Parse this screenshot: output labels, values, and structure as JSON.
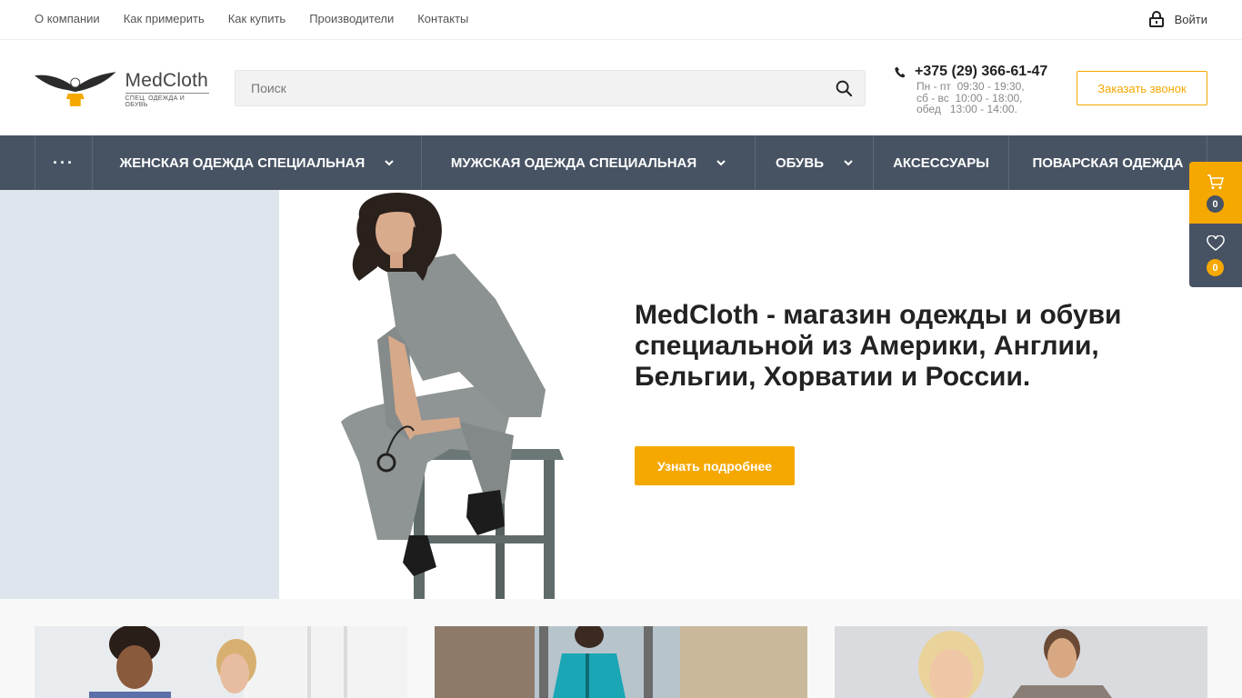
{
  "topbar": {
    "links": [
      "О компании",
      "Как примерить",
      "Как купить",
      "Производители",
      "Контакты"
    ],
    "login_label": "Войти"
  },
  "header": {
    "logo_title": "MedCloth",
    "logo_subtitle": "СПЕЦ. ОДЕЖДА И ОБУВЬ",
    "search_placeholder": "Поиск",
    "phone": "+375 (29) 366-61-47",
    "hours": [
      "Пн - пт  09:30 - 19:30,",
      "сб - вс  10:00 - 18:00,",
      "обед   13:00 - 14:00."
    ],
    "callback_label": "Заказать звонок"
  },
  "nav": {
    "more_label": "···",
    "items": [
      {
        "label": "Женская одежда специальная",
        "dropdown": true
      },
      {
        "label": "Мужская одежда специальная",
        "dropdown": true
      },
      {
        "label": "Обувь",
        "dropdown": true
      },
      {
        "label": "Аксессуары",
        "dropdown": false
      },
      {
        "label": "Поварская одежда",
        "dropdown": false
      }
    ]
  },
  "hero": {
    "title": "MedCloth - магазин одежды и обуви специальной из Америки, Англии, Бельгии, Хорватии и России.",
    "button_label": "Узнать подробнее"
  },
  "side": {
    "cart_count": "0",
    "favorites_count": "0"
  },
  "colors": {
    "accent": "#f5a800",
    "nav_bg": "#475363",
    "hero_left_bg": "#dfe5ed"
  },
  "icons": {
    "login": "lock-icon",
    "search": "search-icon",
    "phone": "phone-icon",
    "cart": "cart-icon",
    "favorites": "heart-icon",
    "dropdown": "chevron-down-icon"
  }
}
